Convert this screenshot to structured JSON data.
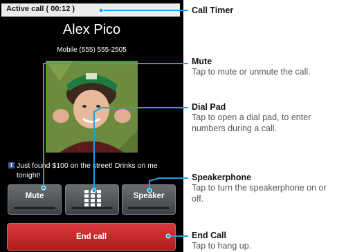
{
  "call": {
    "status": "Active call ( 00:12 )",
    "caller_name": "Alex Pico",
    "caller_number": "Mobile (555) 555-2505",
    "social_status": "Just found $100 on the street! Drinks on me tonight!",
    "social_icon": "facebook-icon"
  },
  "buttons": {
    "mute": "Mute",
    "dialpad_icon": "dialpad-grid-icon",
    "speaker": "Speaker",
    "end_call": "End call"
  },
  "callouts": {
    "timer": {
      "title": "Call Timer"
    },
    "mute": {
      "title": "Mute",
      "desc": "Tap to mute or unmute the call."
    },
    "dialpad": {
      "title": "Dial Pad",
      "desc": "Tap to open a dial pad, to enter numbers during a call."
    },
    "speaker": {
      "title": "Speakerphone",
      "desc": "Tap to turn the speakerphone on or off."
    },
    "end": {
      "title": "End Call",
      "desc": "Tap to hang up."
    }
  },
  "colors": {
    "callout_line": "#1aa3e0",
    "end_call": "#c92a2a"
  }
}
